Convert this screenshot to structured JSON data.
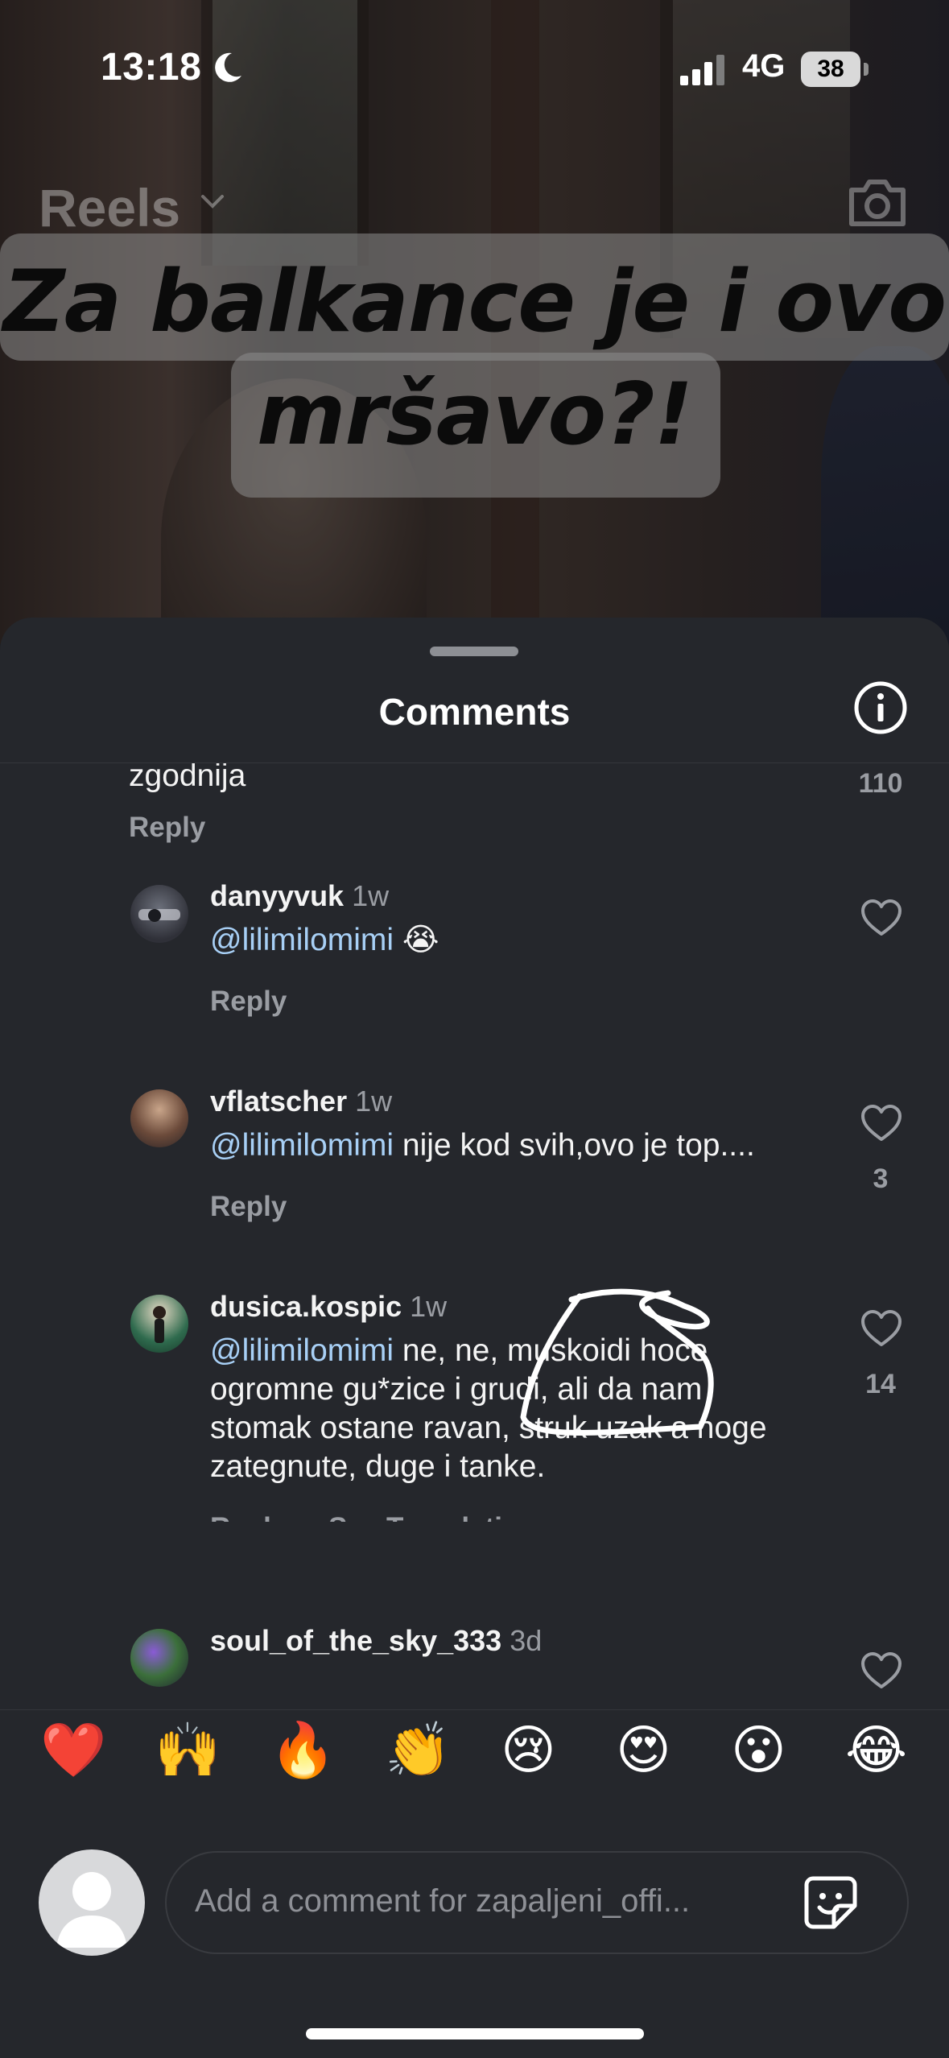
{
  "status_bar": {
    "time": "13:18",
    "network": "4G",
    "battery": "38"
  },
  "reels": {
    "title": "Reels",
    "caption": [
      "Za balkance je i ovo",
      "mršavo?!"
    ]
  },
  "sheet": {
    "title": "Comments"
  },
  "comments": [
    {
      "text_tail": "zgodnija",
      "reply": "Reply",
      "likes": "110"
    },
    {
      "user": "danyyvuk",
      "time": "1w",
      "mention": "@lilimilomimi",
      "text": " 😭",
      "reply": "Reply",
      "likes": ""
    },
    {
      "user": "vflatscher",
      "time": "1w",
      "mention": "@lilimilomimi",
      "text": " nije kod svih,ovo je top....",
      "reply": "Reply",
      "likes": "3"
    },
    {
      "user": "dusica.kospic",
      "time": "1w",
      "mention": "@lilimilomimi",
      "text": " ne, ne, muskoidi hoce ogromne gu*zice i grudi, ali da nam stomak ostane ravan, struk uzak a noge zategnute, duge i tanke.",
      "reply": "Reply",
      "translate": "See Translation",
      "likes": "14"
    },
    {
      "user": "soul_of_the_sky_333",
      "time": "3d"
    }
  ],
  "reactions": [
    "❤️",
    "🙌",
    "🔥",
    "👏",
    "😢",
    "😍",
    "😮",
    "😂"
  ],
  "composer": {
    "placeholder": "Add a comment for zapaljeni_offi..."
  },
  "colors": {
    "sheet": "#25272c",
    "mention": "#a8d0f6",
    "secondary": "#9a9da3"
  }
}
